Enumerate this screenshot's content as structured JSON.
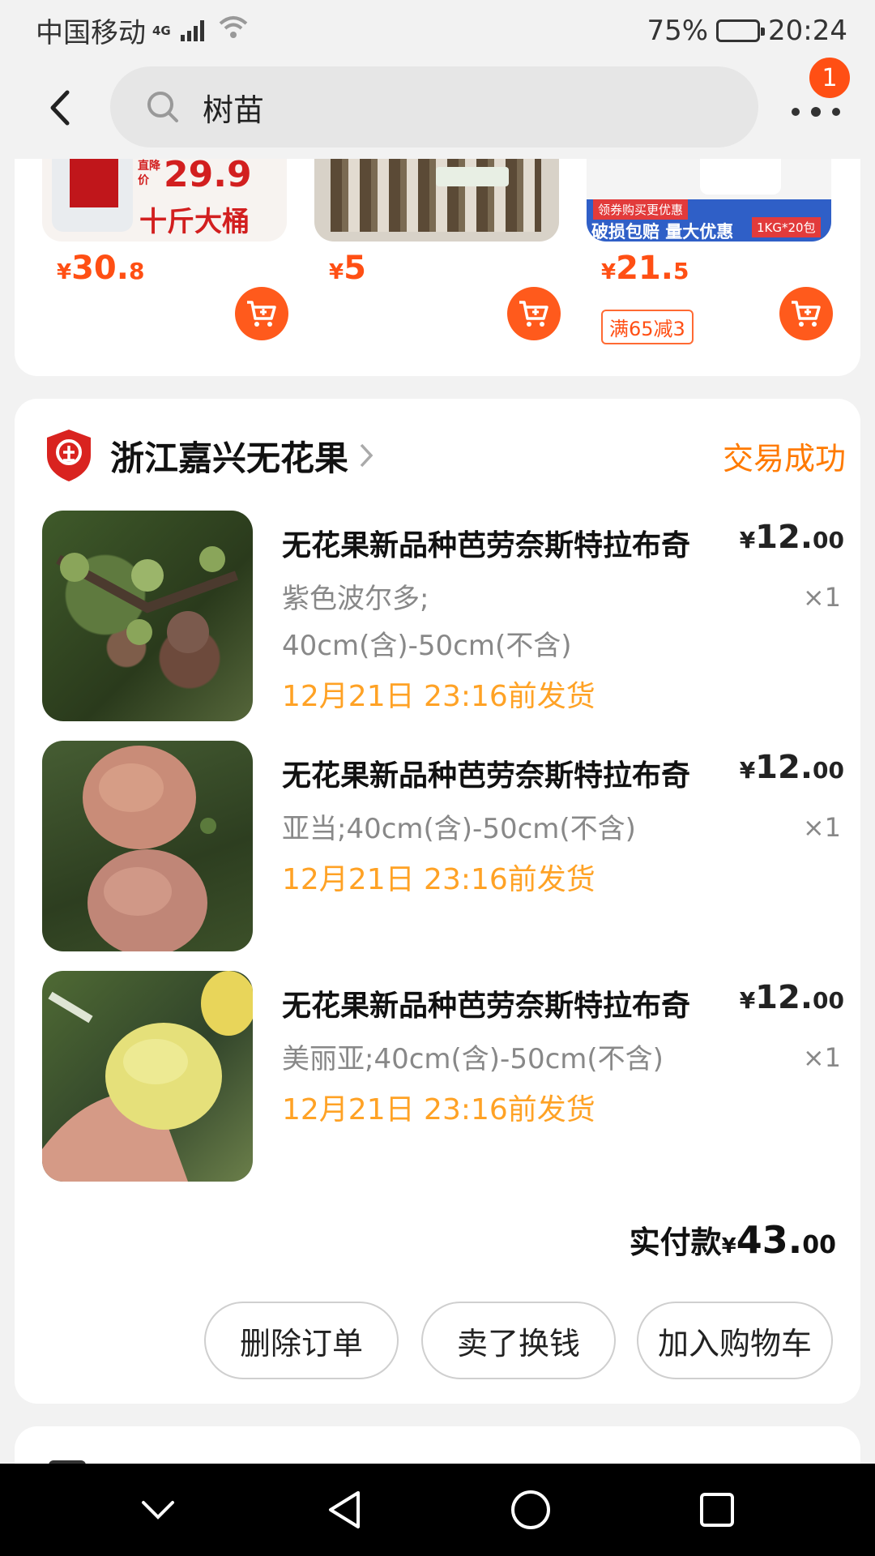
{
  "status_bar": {
    "carrier": "中国移动",
    "network": "4G",
    "battery": "75%",
    "battery_level": 0.75,
    "time": "20:24"
  },
  "header": {
    "search_text": "树苗",
    "notification_count": "1"
  },
  "recommend": [
    {
      "price_cur": "¥",
      "price_int": "30.",
      "price_dec": "8",
      "image_texts": [
        "直降价",
        "29.9",
        "十斤大桶"
      ]
    },
    {
      "price_cur": "¥",
      "price_int": "5",
      "price_dec": ""
    },
    {
      "price_cur": "¥",
      "price_int": "21.",
      "price_dec": "5",
      "promo": "满65减3",
      "image_texts": [
        "领券购买更优惠",
        "破损包赔 量大优惠",
        "1KG*20包"
      ]
    }
  ],
  "order": {
    "shop_name": "浙江嘉兴无花果",
    "status": "交易成功",
    "items": [
      {
        "title": "无花果新品种芭劳奈斯特拉布奇",
        "spec_lines": [
          "紫色波尔多;",
          "40cm(含)-50cm(不含)"
        ],
        "price_cur": "¥",
        "price_int": "12.",
        "price_dec": "00",
        "qty": "×1",
        "ship": "12月21日 23:16前发货"
      },
      {
        "title": "无花果新品种芭劳奈斯特拉布奇",
        "spec_lines": [
          "亚当;40cm(含)-50cm(不含)"
        ],
        "price_cur": "¥",
        "price_int": "12.",
        "price_dec": "00",
        "qty": "×1",
        "ship": "12月21日 23:16前发货"
      },
      {
        "title": "无花果新品种芭劳奈斯特拉布奇",
        "spec_lines": [
          "美丽亚;40cm(含)-50cm(不含)"
        ],
        "price_cur": "¥",
        "price_int": "12.",
        "price_dec": "00",
        "qty": "×1",
        "ship": "12月21日 23:16前发货"
      }
    ],
    "total_label": "实付款",
    "total_cur": "¥",
    "total_int": "43.",
    "total_dec": "00",
    "buttons": [
      "删除订单",
      "卖了换钱",
      "加入购物车"
    ]
  },
  "colors": {
    "accent": "#ff4f14",
    "status_orange": "#ff7a00",
    "ship_orange": "#ffa225"
  }
}
